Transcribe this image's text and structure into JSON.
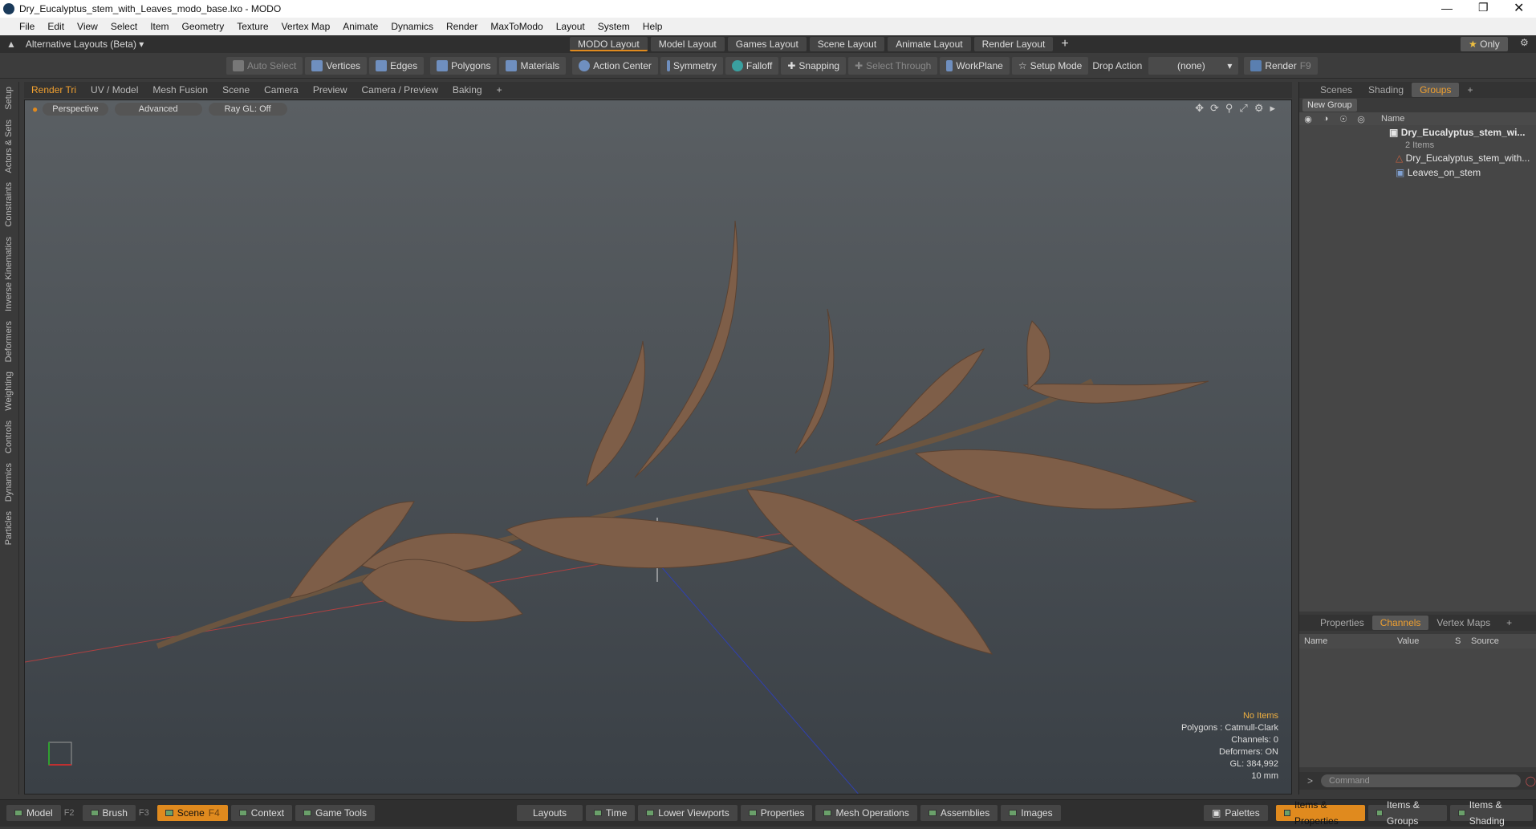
{
  "window": {
    "title": "Dry_Eucalyptus_stem_with_Leaves_modo_base.lxo - MODO"
  },
  "menu": [
    "File",
    "Edit",
    "View",
    "Select",
    "Item",
    "Geometry",
    "Texture",
    "Vertex Map",
    "Animate",
    "Dynamics",
    "Render",
    "MaxToModo",
    "Layout",
    "System",
    "Help"
  ],
  "layoutbar": {
    "alt_layouts": "Alternative Layouts (Beta)",
    "tabs": [
      "MODO Layout",
      "Model Layout",
      "Games Layout",
      "Scene Layout",
      "Animate Layout",
      "Render Layout"
    ],
    "only": "Only"
  },
  "toolbar": {
    "auto_select": "Auto Select",
    "vertices": "Vertices",
    "edges": "Edges",
    "polygons": "Polygons",
    "materials": "Materials",
    "action_center": "Action Center",
    "symmetry": "Symmetry",
    "falloff": "Falloff",
    "snapping": "Snapping",
    "select_through": "Select Through",
    "workplane": "WorkPlane",
    "setup_mode": "Setup Mode",
    "drop_action": "Drop Action",
    "none": "(none)",
    "render": "Render",
    "render_key": "F9"
  },
  "viewport_tabs": [
    "Render Tri",
    "UV / Model",
    "Mesh Fusion",
    "Scene",
    "Camera",
    "Preview",
    "Camera / Preview",
    "Baking"
  ],
  "viewport": {
    "perspective": "Perspective",
    "advanced": "Advanced",
    "raygl": "Ray GL: Off",
    "info": {
      "no_items": "No Items",
      "polygons": "Polygons : Catmull-Clark",
      "channels": "Channels: 0",
      "deformers": "Deformers: ON",
      "gl": "GL: 384,992",
      "scale": "10 mm"
    }
  },
  "left_tabs": [
    "Setup",
    "Actors & Sets",
    "Constraints",
    "Inverse Kinematics",
    "Deformers",
    "Weighting",
    "Controls",
    "Dynamics",
    "Particles"
  ],
  "right_top": {
    "tabs": [
      "Scenes",
      "Shading",
      "Groups"
    ],
    "new_group": "New Group",
    "name_col": "Name",
    "group_name": "Dry_Eucalyptus_stem_wi...",
    "group_count": "2 Items",
    "children": [
      "Dry_Eucalyptus_stem_with...",
      "Leaves_on_stem"
    ]
  },
  "right_bottom": {
    "tabs": [
      "Properties",
      "Channels",
      "Vertex Maps"
    ],
    "cols": {
      "name": "Name",
      "value": "Value",
      "s": "S",
      "source": "Source"
    },
    "command": "Command"
  },
  "bottombar": {
    "model": "Model",
    "model_key": "F2",
    "brush": "Brush",
    "brush_key": "F3",
    "scene": "Scene",
    "scene_key": "F4",
    "context": "Context",
    "game_tools": "Game Tools",
    "layouts": "Layouts",
    "time": "Time",
    "lower_viewports": "Lower Viewports",
    "properties": "Properties",
    "mesh_operations": "Mesh Operations",
    "assemblies": "Assemblies",
    "images": "Images",
    "palettes": "Palettes",
    "items_properties": "Items & Properties",
    "items_groups": "Items & Groups",
    "items_shading": "Items & Shading"
  },
  "colors": {
    "accent": "#e08a1e",
    "leaf": "#8a6a52",
    "stem": "#6b5540"
  }
}
